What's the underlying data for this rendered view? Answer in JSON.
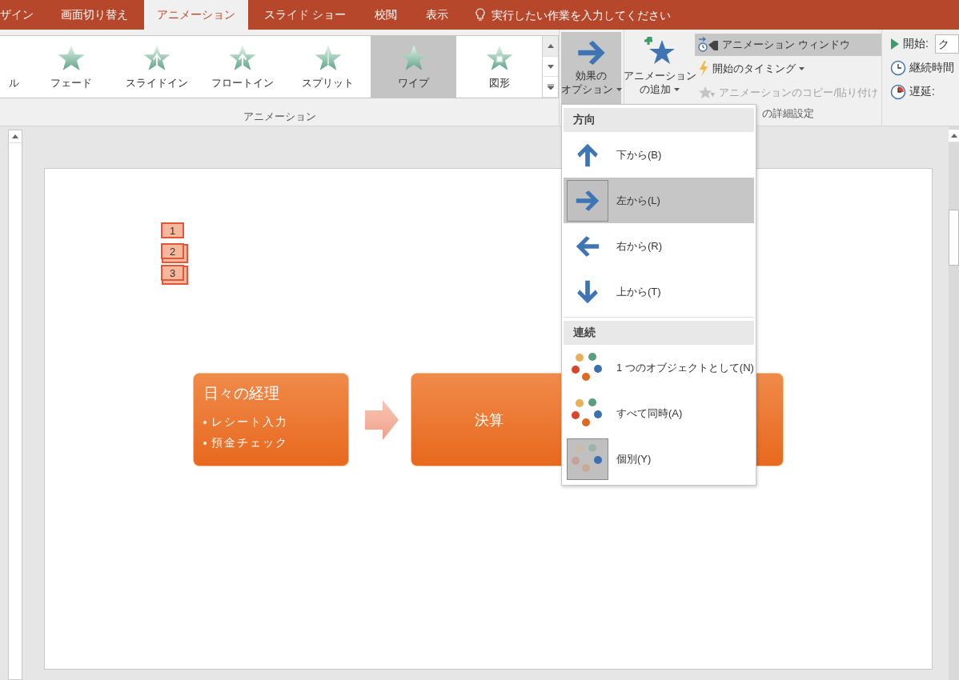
{
  "tabs": [
    {
      "label": "ザイン",
      "selected": false
    },
    {
      "label": "画面切り替え",
      "selected": false
    },
    {
      "label": "アニメーション",
      "selected": true
    },
    {
      "label": "スライド ショー",
      "selected": false
    },
    {
      "label": "校閲",
      "selected": false
    },
    {
      "label": "表示",
      "selected": false
    }
  ],
  "tell_me": {
    "placeholder": "実行したい作業を入力してください"
  },
  "gallery": {
    "group_label": "アニメーション",
    "items": [
      {
        "label": "ル",
        "kind": "cut",
        "selected": false
      },
      {
        "label": "フェード",
        "kind": "fade",
        "selected": false
      },
      {
        "label": "スライドイン",
        "kind": "fly",
        "selected": false
      },
      {
        "label": "フロートイン",
        "kind": "float",
        "selected": false
      },
      {
        "label": "スプリット",
        "kind": "split",
        "selected": false
      },
      {
        "label": "ワイプ",
        "kind": "wipe",
        "selected": true
      },
      {
        "label": "図形",
        "kind": "shape",
        "selected": false
      }
    ]
  },
  "effect_options": {
    "lines": [
      "効果の",
      "オプション"
    ],
    "pressed": true
  },
  "add_animation": {
    "lines": [
      "アニメーション",
      "の追加"
    ]
  },
  "advanced": {
    "group_label": "の詳細設定",
    "items": [
      {
        "label": "アニメーション ウィンドウ",
        "kind": "pane",
        "selected": true,
        "disabled": false
      },
      {
        "label": "開始のタイミング",
        "kind": "trigger",
        "selected": false,
        "disabled": false
      },
      {
        "label": "アニメーションのコピー/貼り付け",
        "kind": "painter",
        "selected": false,
        "disabled": true
      }
    ]
  },
  "timing": {
    "items": [
      {
        "label": "開始:",
        "kind": "start",
        "value": "ク"
      },
      {
        "label": "継続時間",
        "kind": "duration"
      },
      {
        "label": "遅延:",
        "kind": "delay"
      }
    ]
  },
  "slide": {
    "tags": [
      {
        "label": "1",
        "stacked": false
      },
      {
        "label": "2",
        "stacked": true
      },
      {
        "label": "3",
        "stacked": true
      }
    ],
    "shapes": [
      {
        "kind": "box",
        "title": "日々の経理",
        "bullets": [
          "レシート入力",
          "預金チェック"
        ]
      },
      {
        "kind": "arrow"
      },
      {
        "kind": "box",
        "text": "決算"
      },
      {
        "kind": "box"
      }
    ]
  },
  "menu": {
    "sections": [
      {
        "heading": "方向",
        "items": [
          {
            "label": "下から(B)",
            "kind": "up",
            "selected": false,
            "highlighted": false
          },
          {
            "label": "左から(L)",
            "kind": "right",
            "selected": true,
            "highlighted": true
          },
          {
            "label": "右から(R)",
            "kind": "left",
            "selected": false,
            "highlighted": false
          },
          {
            "label": "上から(T)",
            "kind": "down",
            "selected": false,
            "highlighted": false
          }
        ]
      },
      {
        "heading": "連続",
        "items": [
          {
            "label": "1 つのオブジェクトとして(N)",
            "kind": "as-one",
            "selected": false,
            "highlighted": false
          },
          {
            "label": "すべて同時(A)",
            "kind": "all-at-once",
            "selected": false,
            "highlighted": false
          },
          {
            "label": "個別(Y)",
            "kind": "by-paragraph",
            "selected": true,
            "highlighted": false
          }
        ]
      }
    ]
  }
}
